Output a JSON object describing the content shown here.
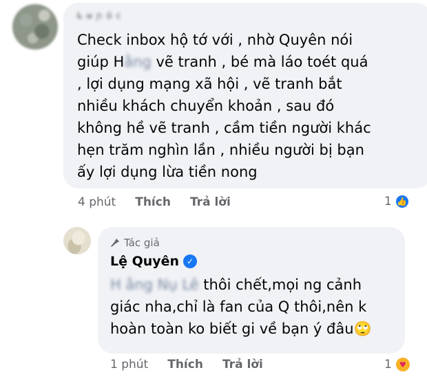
{
  "comment1": {
    "author_name_blurred": "L̶ u̶ ɲ ɑ́ c",
    "line1": "Check inbox hộ tớ với , nhờ Quyên  nói",
    "line2_prefix": "giúp H",
    "line2_blurred": "ằng",
    "line2_suffix": " vẽ tranh , bé mà láo toét quá",
    "line3": ", lợi dụng mạng xã hội , vẽ tranh bắt",
    "line4": "nhiều khách chuyển khoản , sau đó",
    "line5": "không hề vẽ tranh , cầm tiền người khác",
    "line6": "hẹn trăm nghìn lần , nhiều người bị bạn",
    "line7": "ấy lợi dụng lừa tiền nong",
    "time": "4 phút",
    "like_label": "Thích",
    "reply_label": "Trả lời",
    "reaction_count": "1",
    "reaction_icon": "like-icon",
    "colors": {
      "like": "#1877f2"
    }
  },
  "comment2": {
    "author_tag": "Tác giả",
    "author_name": "Lệ Quyên",
    "mention_blurred": "H ằng Nụ Lê",
    "line1_suffix": " thôi chết,mọi ng cảnh",
    "line2": "giác nha,chỉ là fan của Q thôi,nên k",
    "line3": "hoàn toàn ko biết gi về bạn ý đâu",
    "emoji": "🙄",
    "time": "1 phút",
    "like_label": "Thích",
    "reply_label": "Trả lời",
    "reaction_count": "1",
    "reaction_icon": "care-icon",
    "colors": {
      "verified": "#1877f2",
      "care": "#f7b125"
    }
  }
}
